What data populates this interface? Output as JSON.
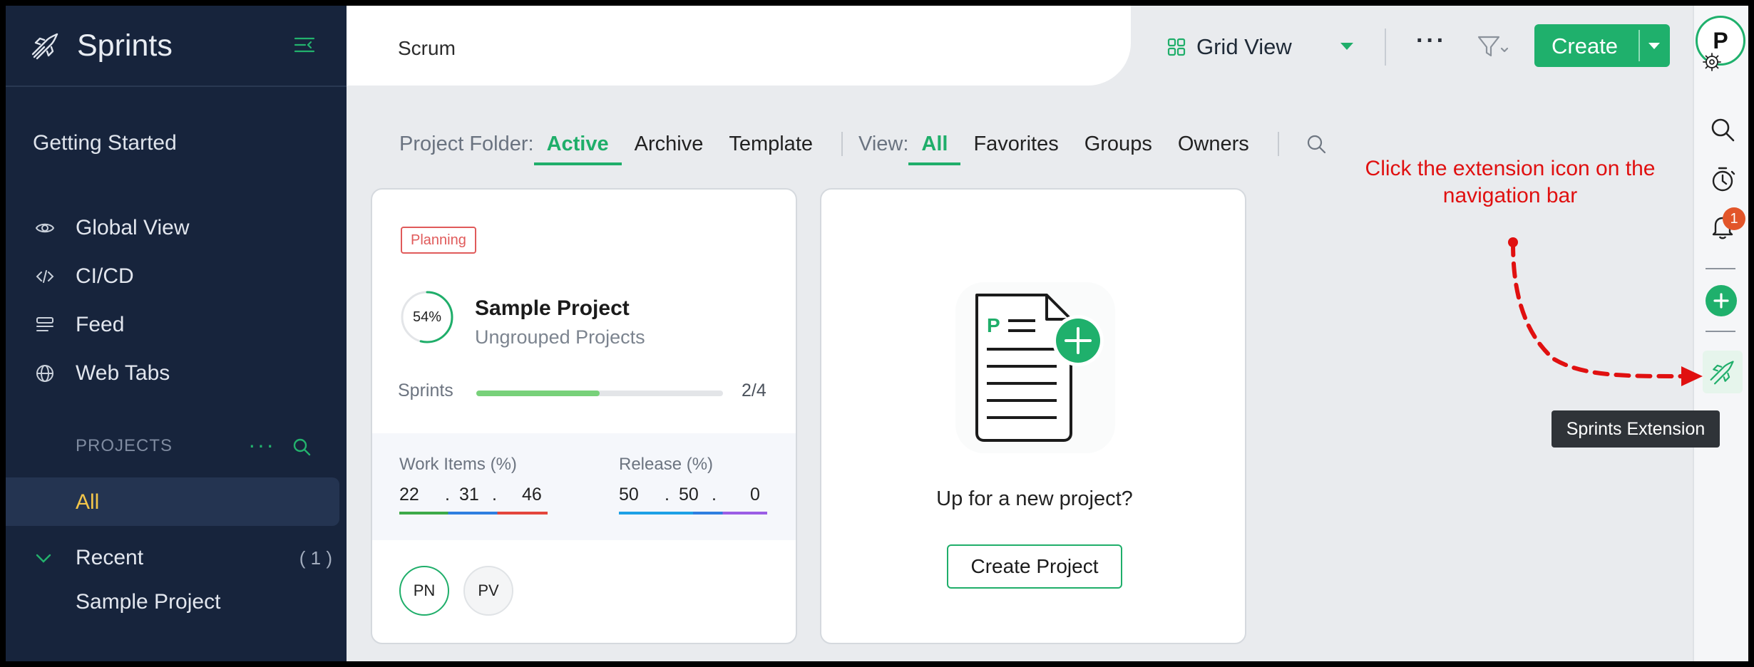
{
  "sidebar": {
    "title": "Sprints",
    "getting_started": "Getting Started",
    "nav": [
      {
        "label": "Global View",
        "icon": "eye-icon"
      },
      {
        "label": "CI/CD",
        "icon": "code-icon"
      },
      {
        "label": "Feed",
        "icon": "feed-icon"
      },
      {
        "label": "Web Tabs",
        "icon": "globe-icon"
      }
    ],
    "projects_heading": "PROJECTS",
    "projects_more": "···",
    "all_label": "All",
    "recent_label": "Recent",
    "recent_count": "( 1 )",
    "sample_project": "Sample Project"
  },
  "header": {
    "tab_label": "Scrum",
    "view_label": "Grid View",
    "more_label": "···",
    "create_label": "Create"
  },
  "rail": {
    "avatar_initial": "P",
    "notification_count": "1",
    "tooltip": "Sprints Extension"
  },
  "filters": {
    "folder_label": "Project Folder:",
    "folder_tabs": [
      "Active",
      "Archive",
      "Template"
    ],
    "view_label": "View:",
    "view_tabs": [
      "All",
      "Favorites",
      "Groups",
      "Owners"
    ]
  },
  "project_card": {
    "status": "Planning",
    "progress_text": "54%",
    "progress_value": 0.54,
    "name": "Sample Project",
    "group": "Ungrouped Projects",
    "sprints_label": "Sprints",
    "sprints_count": "2/4",
    "sprints_fraction": 0.5,
    "work_items_label": "Work Items (%)",
    "work_items": [
      "22",
      ".",
      "31",
      ".",
      "46"
    ],
    "release_label": "Release (%)",
    "release": [
      "50",
      ".",
      "50",
      ".",
      "0"
    ],
    "members": [
      "PN",
      "PV"
    ]
  },
  "new_project_card": {
    "prompt": "Up for a new project?",
    "button": "Create Project",
    "doc_letter": "P"
  },
  "annotation": {
    "line1": "Click the extension icon on the",
    "line2": "navigation bar"
  },
  "colors": {
    "accent": "#1fb06c",
    "sidebar_bg": "#17243c",
    "annotation": "#e01010"
  }
}
